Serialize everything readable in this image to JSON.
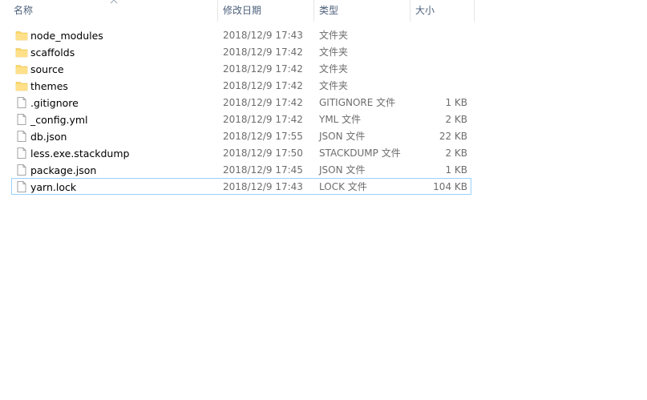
{
  "columns": {
    "name": "名称",
    "date": "修改日期",
    "type": "类型",
    "size": "大小"
  },
  "colors": {
    "header_text": "#4c607a",
    "folder_yellow": "#ffd966",
    "focus_border": "#99d1ff",
    "secondary_text": "#6d6d6d"
  },
  "files": [
    {
      "name": "node_modules",
      "date": "2018/12/9 17:43",
      "type": "文件夹",
      "size": "",
      "icon": "folder-icon"
    },
    {
      "name": "scaffolds",
      "date": "2018/12/9 17:42",
      "type": "文件夹",
      "size": "",
      "icon": "folder-icon"
    },
    {
      "name": "source",
      "date": "2018/12/9 17:42",
      "type": "文件夹",
      "size": "",
      "icon": "folder-icon"
    },
    {
      "name": "themes",
      "date": "2018/12/9 17:42",
      "type": "文件夹",
      "size": "",
      "icon": "folder-icon"
    },
    {
      "name": ".gitignore",
      "date": "2018/12/9 17:42",
      "type": "GITIGNORE 文件",
      "size": "1 KB",
      "icon": "file-icon"
    },
    {
      "name": "_config.yml",
      "date": "2018/12/9 17:42",
      "type": "YML 文件",
      "size": "2 KB",
      "icon": "file-icon"
    },
    {
      "name": "db.json",
      "date": "2018/12/9 17:55",
      "type": "JSON 文件",
      "size": "22 KB",
      "icon": "file-icon"
    },
    {
      "name": "less.exe.stackdump",
      "date": "2018/12/9 17:50",
      "type": "STACKDUMP 文件",
      "size": "2 KB",
      "icon": "file-icon"
    },
    {
      "name": "package.json",
      "date": "2018/12/9 17:45",
      "type": "JSON 文件",
      "size": "1 KB",
      "icon": "file-icon"
    },
    {
      "name": "yarn.lock",
      "date": "2018/12/9 17:43",
      "type": "LOCK 文件",
      "size": "104 KB",
      "icon": "file-icon"
    }
  ]
}
